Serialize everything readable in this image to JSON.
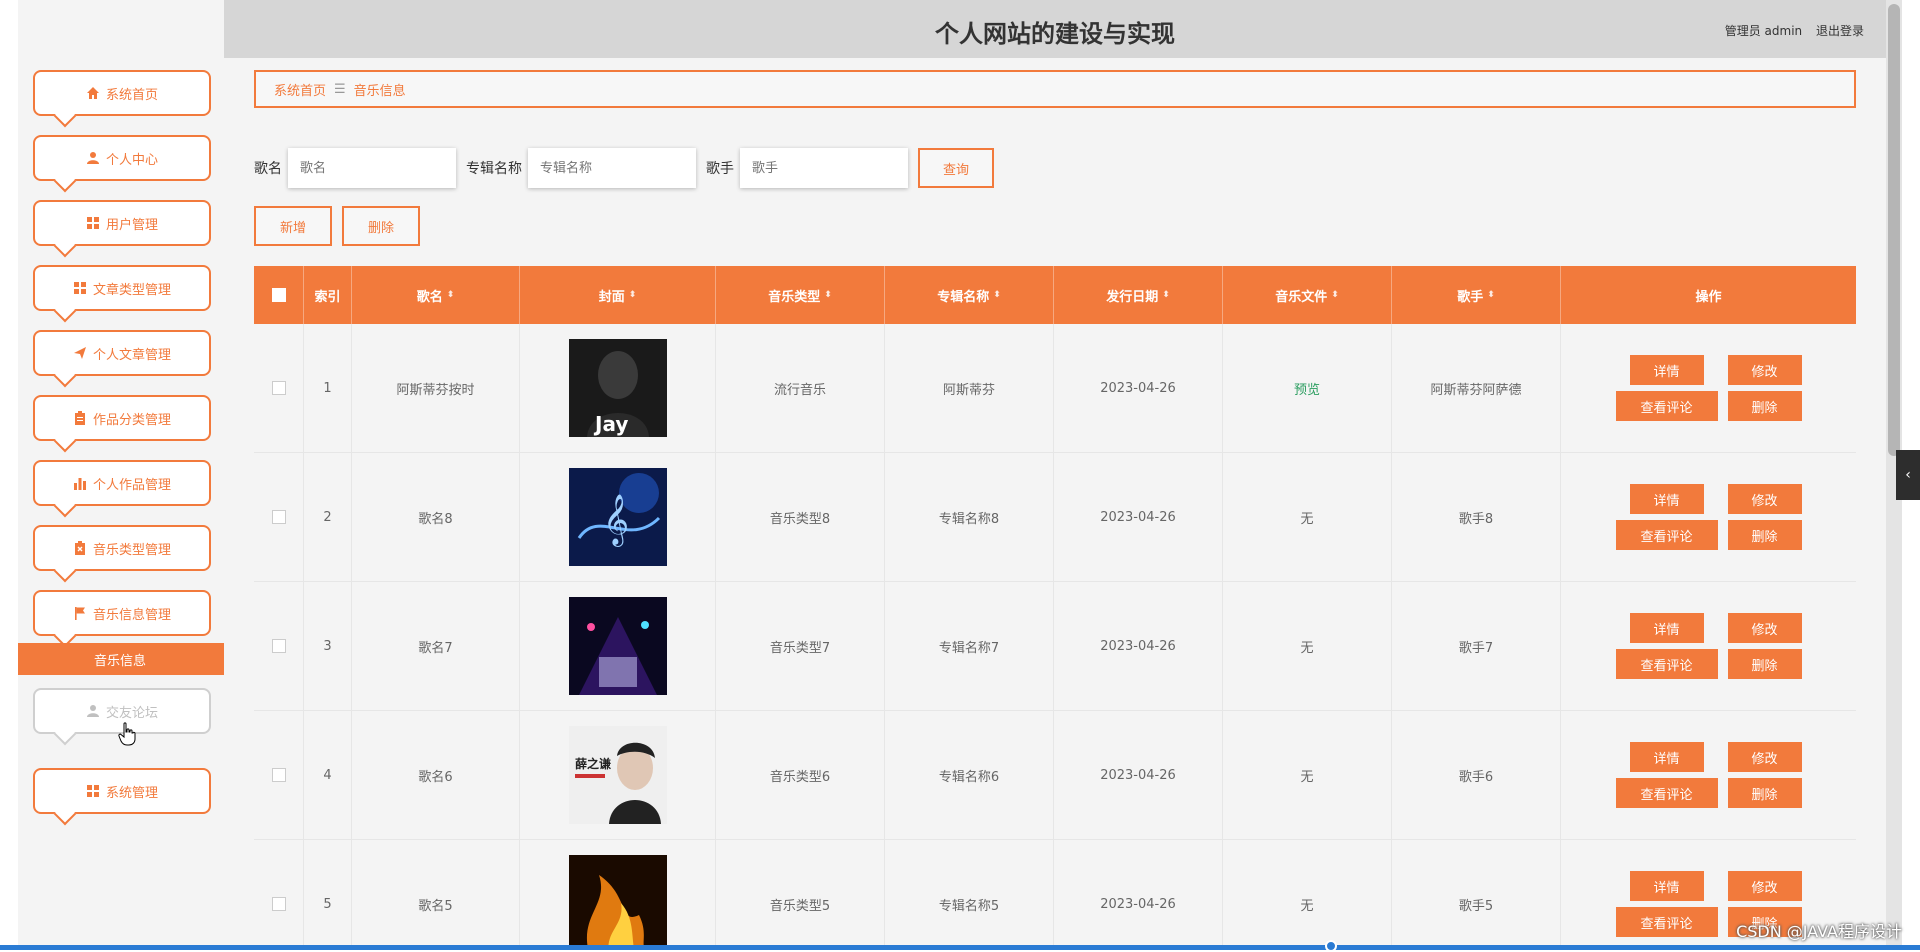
{
  "header": {
    "title": "个人网站的建设与实现",
    "user": "管理员 admin",
    "logout": "退出登录"
  },
  "sidebar": {
    "items": [
      {
        "label": "系统首页",
        "icon": "home-icon"
      },
      {
        "label": "个人中心",
        "icon": "user-icon"
      },
      {
        "label": "用户管理",
        "icon": "grid-icon"
      },
      {
        "label": "文章类型管理",
        "icon": "grid-icon"
      },
      {
        "label": "个人文章管理",
        "icon": "paper-plane-icon"
      },
      {
        "label": "作品分类管理",
        "icon": "clipboard-icon"
      },
      {
        "label": "个人作品管理",
        "icon": "bar-chart-icon"
      },
      {
        "label": "音乐类型管理",
        "icon": "clipboard-x-icon"
      },
      {
        "label": "音乐信息管理",
        "icon": "flag-icon"
      },
      {
        "label": "交友论坛",
        "icon": "user-icon"
      },
      {
        "label": "系统管理",
        "icon": "grid-icon"
      }
    ],
    "sub_active": "音乐信息"
  },
  "breadcrumb": {
    "home": "系统首页",
    "separator": "☰",
    "current": "音乐信息"
  },
  "search": {
    "song_label": "歌名",
    "song_placeholder": "歌名",
    "album_label": "专辑名称",
    "album_placeholder": "专辑名称",
    "singer_label": "歌手",
    "singer_placeholder": "歌手",
    "query_button": "查询"
  },
  "actions": {
    "add": "新增",
    "delete": "删除"
  },
  "table": {
    "headers": [
      "索引",
      "歌名",
      "封面",
      "音乐类型",
      "专辑名称",
      "发行日期",
      "音乐文件",
      "歌手",
      "操作"
    ],
    "rows": [
      {
        "index": "1",
        "song": "阿斯蒂芬按时",
        "type": "流行音乐",
        "album": "阿斯蒂芬",
        "date": "2023-04-26",
        "file": "预览",
        "singer": "阿斯蒂芬阿萨德",
        "cover_text": "Jay"
      },
      {
        "index": "2",
        "song": "歌名8",
        "type": "音乐类型8",
        "album": "专辑名称8",
        "date": "2023-04-26",
        "file": "无",
        "singer": "歌手8",
        "cover_text": ""
      },
      {
        "index": "3",
        "song": "歌名7",
        "type": "音乐类型7",
        "album": "专辑名称7",
        "date": "2023-04-26",
        "file": "无",
        "singer": "歌手7",
        "cover_text": ""
      },
      {
        "index": "4",
        "song": "歌名6",
        "type": "音乐类型6",
        "album": "专辑名称6",
        "date": "2023-04-26",
        "file": "无",
        "singer": "歌手6",
        "cover_text": "薛之谦"
      },
      {
        "index": "5",
        "song": "歌名5",
        "type": "音乐类型5",
        "album": "专辑名称5",
        "date": "2023-04-26",
        "file": "无",
        "singer": "歌手5",
        "cover_text": ""
      }
    ],
    "ops": {
      "detail": "详情",
      "edit": "修改",
      "comments": "查看评论",
      "delete": "删除"
    }
  },
  "watermark": "CSDN @JAVA程序设计",
  "colors": {
    "accent": "#f27a3c",
    "preview_link": "#2a9d5f"
  }
}
